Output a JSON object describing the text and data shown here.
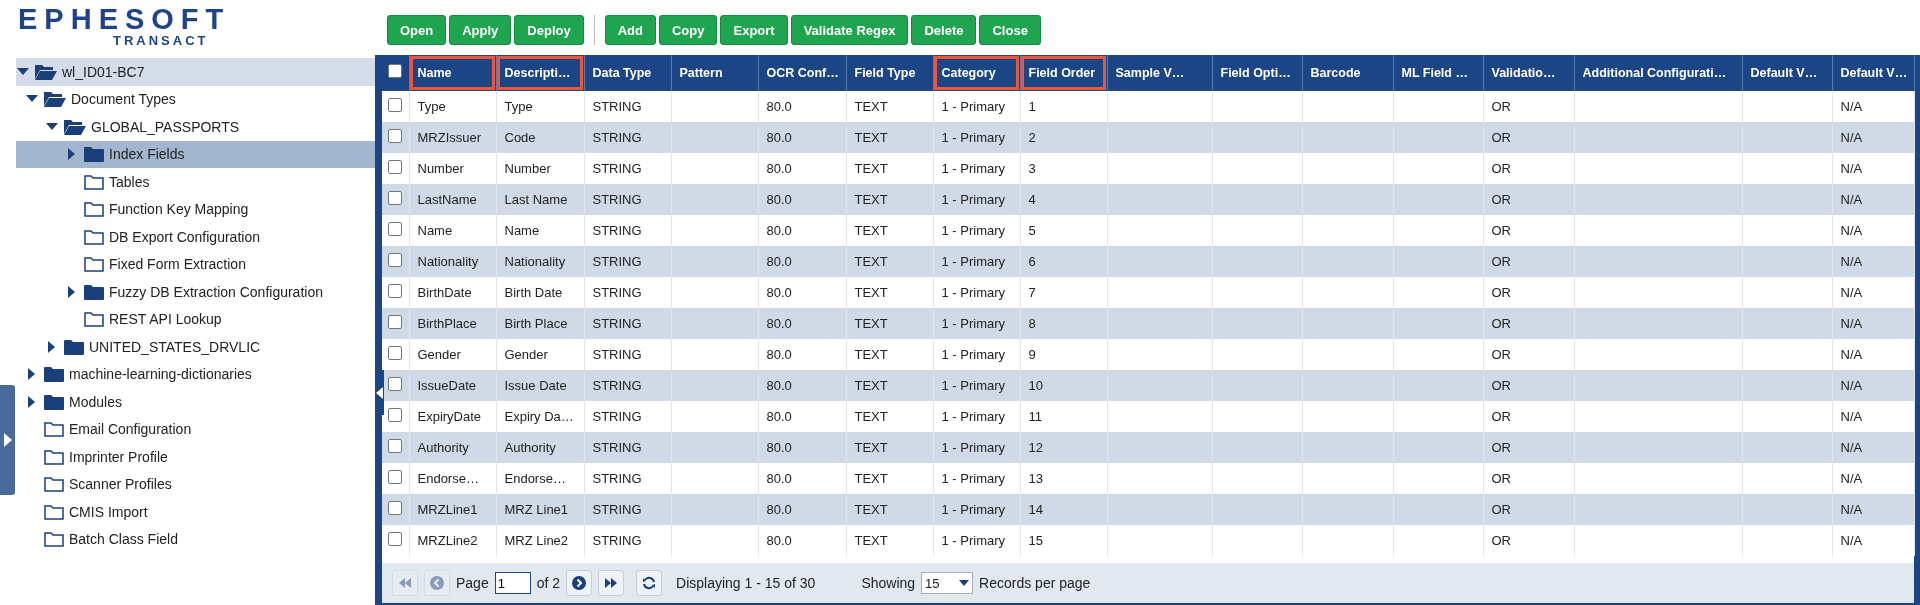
{
  "logo": {
    "name": "EPHESOFT",
    "tagline": "TRANSACT"
  },
  "toolbar": {
    "groups": [
      [
        "Open",
        "Apply",
        "Deploy"
      ],
      [
        "Add",
        "Copy",
        "Export",
        "Validate Regex",
        "Delete",
        "Close"
      ]
    ]
  },
  "tree": [
    {
      "label": "wl_ID01-BC7",
      "kind": "root",
      "expanded": true,
      "selected": false,
      "children": [
        {
          "label": "Document Types",
          "kind": "branch",
          "expanded": true,
          "selected": false,
          "children": [
            {
              "label": "GLOBAL_PASSPORTS",
              "kind": "branch",
              "expanded": true,
              "selected": false,
              "children": [
                {
                  "label": "Index Fields",
                  "kind": "branch",
                  "expanded": false,
                  "selected": true
                },
                {
                  "label": "Tables",
                  "kind": "leaf",
                  "expanded": false,
                  "selected": false
                },
                {
                  "label": "Function Key Mapping",
                  "kind": "leaf",
                  "expanded": false,
                  "selected": false
                },
                {
                  "label": "DB Export Configuration",
                  "kind": "leaf",
                  "expanded": false,
                  "selected": false
                },
                {
                  "label": "Fixed Form Extraction",
                  "kind": "leaf",
                  "expanded": false,
                  "selected": false
                },
                {
                  "label": "Fuzzy DB Extraction Configuration",
                  "kind": "branch",
                  "expanded": false,
                  "selected": false
                },
                {
                  "label": "REST API Lookup",
                  "kind": "leaf",
                  "expanded": false,
                  "selected": false
                }
              ]
            },
            {
              "label": "UNITED_STATES_DRVLIC",
              "kind": "branch",
              "expanded": false,
              "selected": false
            }
          ]
        },
        {
          "label": "machine-learning-dictionaries",
          "kind": "branch",
          "expanded": false,
          "selected": false
        },
        {
          "label": "Modules",
          "kind": "branch",
          "expanded": false,
          "selected": false
        },
        {
          "label": "Email Configuration",
          "kind": "leaf",
          "expanded": false,
          "selected": false
        },
        {
          "label": "Imprinter Profile",
          "kind": "leaf",
          "expanded": false,
          "selected": false
        },
        {
          "label": "Scanner Profiles",
          "kind": "leaf",
          "expanded": false,
          "selected": false
        },
        {
          "label": "CMIS Import",
          "kind": "leaf",
          "expanded": false,
          "selected": false
        },
        {
          "label": "Batch Class Field",
          "kind": "leaf",
          "expanded": false,
          "selected": false
        }
      ]
    }
  ],
  "table": {
    "select_all_checked": false,
    "columns": [
      {
        "label": "Name",
        "highlighted": true
      },
      {
        "label": "Descripti…",
        "highlighted": true
      },
      {
        "label": "Data Type",
        "highlighted": false
      },
      {
        "label": "Pattern",
        "highlighted": false
      },
      {
        "label": "OCR Conf…",
        "highlighted": false
      },
      {
        "label": "Field Type",
        "highlighted": false
      },
      {
        "label": "Category",
        "highlighted": true
      },
      {
        "label": "Field Order",
        "highlighted": true
      },
      {
        "label": "Sample V…",
        "highlighted": false
      },
      {
        "label": "Field Opti…",
        "highlighted": false
      },
      {
        "label": "Barcode",
        "highlighted": false
      },
      {
        "label": "ML Field …",
        "highlighted": false
      },
      {
        "label": "Validatio…",
        "highlighted": false
      },
      {
        "label": "Additional Configurati…",
        "highlighted": false
      },
      {
        "label": "Default V…",
        "highlighted": false
      },
      {
        "label": "Default V…",
        "highlighted": false
      }
    ],
    "rows": [
      {
        "checked": false,
        "name": "Type",
        "description": "Type",
        "data_type": "STRING",
        "ocr_confidence": "80.0",
        "field_type": "TEXT",
        "category": "1 - Primary",
        "field_order": "1",
        "validation": "OR",
        "default_value": "N/A"
      },
      {
        "checked": false,
        "name": "MRZIssuer",
        "description": "Code",
        "data_type": "STRING",
        "ocr_confidence": "80.0",
        "field_type": "TEXT",
        "category": "1 - Primary",
        "field_order": "2",
        "validation": "OR",
        "default_value": "N/A"
      },
      {
        "checked": false,
        "name": "Number",
        "description": "Number",
        "data_type": "STRING",
        "ocr_confidence": "80.0",
        "field_type": "TEXT",
        "category": "1 - Primary",
        "field_order": "3",
        "validation": "OR",
        "default_value": "N/A"
      },
      {
        "checked": false,
        "name": "LastName",
        "description": "Last Name",
        "data_type": "STRING",
        "ocr_confidence": "80.0",
        "field_type": "TEXT",
        "category": "1 - Primary",
        "field_order": "4",
        "validation": "OR",
        "default_value": "N/A"
      },
      {
        "checked": false,
        "name": "Name",
        "description": "Name",
        "data_type": "STRING",
        "ocr_confidence": "80.0",
        "field_type": "TEXT",
        "category": "1 - Primary",
        "field_order": "5",
        "validation": "OR",
        "default_value": "N/A"
      },
      {
        "checked": false,
        "name": "Nationality",
        "description": "Nationality",
        "data_type": "STRING",
        "ocr_confidence": "80.0",
        "field_type": "TEXT",
        "category": "1 - Primary",
        "field_order": "6",
        "validation": "OR",
        "default_value": "N/A"
      },
      {
        "checked": false,
        "name": "BirthDate",
        "description": "Birth Date",
        "data_type": "STRING",
        "ocr_confidence": "80.0",
        "field_type": "TEXT",
        "category": "1 - Primary",
        "field_order": "7",
        "validation": "OR",
        "default_value": "N/A"
      },
      {
        "checked": false,
        "name": "BirthPlace",
        "description": "Birth Place",
        "data_type": "STRING",
        "ocr_confidence": "80.0",
        "field_type": "TEXT",
        "category": "1 - Primary",
        "field_order": "8",
        "validation": "OR",
        "default_value": "N/A"
      },
      {
        "checked": false,
        "name": "Gender",
        "description": "Gender",
        "data_type": "STRING",
        "ocr_confidence": "80.0",
        "field_type": "TEXT",
        "category": "1 - Primary",
        "field_order": "9",
        "validation": "OR",
        "default_value": "N/A"
      },
      {
        "checked": false,
        "name": "IssueDate",
        "description": "Issue Date",
        "data_type": "STRING",
        "ocr_confidence": "80.0",
        "field_type": "TEXT",
        "category": "1 - Primary",
        "field_order": "10",
        "validation": "OR",
        "default_value": "N/A"
      },
      {
        "checked": false,
        "name": "ExpiryDate",
        "description": "Expiry Da…",
        "data_type": "STRING",
        "ocr_confidence": "80.0",
        "field_type": "TEXT",
        "category": "1 - Primary",
        "field_order": "11",
        "validation": "OR",
        "default_value": "N/A"
      },
      {
        "checked": false,
        "name": "Authority",
        "description": "Authority",
        "data_type": "STRING",
        "ocr_confidence": "80.0",
        "field_type": "TEXT",
        "category": "1 - Primary",
        "field_order": "12",
        "validation": "OR",
        "default_value": "N/A"
      },
      {
        "checked": false,
        "name": "Endorse…",
        "description": "Endorse…",
        "data_type": "STRING",
        "ocr_confidence": "80.0",
        "field_type": "TEXT",
        "category": "1 - Primary",
        "field_order": "13",
        "validation": "OR",
        "default_value": "N/A"
      },
      {
        "checked": false,
        "name": "MRZLine1",
        "description": "MRZ Line1",
        "data_type": "STRING",
        "ocr_confidence": "80.0",
        "field_type": "TEXT",
        "category": "1 - Primary",
        "field_order": "14",
        "validation": "OR",
        "default_value": "N/A"
      },
      {
        "checked": false,
        "name": "MRZLine2",
        "description": "MRZ Line2",
        "data_type": "STRING",
        "ocr_confidence": "80.0",
        "field_type": "TEXT",
        "category": "1 - Primary",
        "field_order": "15",
        "validation": "OR",
        "default_value": "N/A"
      }
    ]
  },
  "pagination": {
    "page_label": "Page",
    "page": "1",
    "of_label": "of 2",
    "first_disabled": true,
    "prev_disabled": true,
    "display": "Displaying 1 - 15 of 30",
    "showing_label": "Showing",
    "per_page": "15",
    "per_page_label": "Records per page"
  }
}
